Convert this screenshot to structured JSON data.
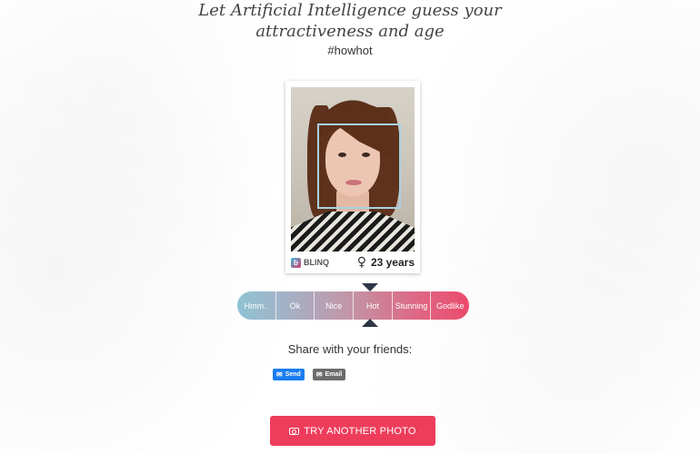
{
  "header": {
    "line1": "Let Artificial Intelligence guess your",
    "line2": "attractiveness and age",
    "hashtag": "#howhot"
  },
  "card": {
    "brand": "BLINQ",
    "brand_logo_letter": "b",
    "gender_symbol": "♀",
    "age": "23 years"
  },
  "rating": {
    "labels": [
      "Hmm..",
      "Ok",
      "Nice",
      "Hot",
      "Stunning",
      "Godlike"
    ],
    "selected": "Hot"
  },
  "share": {
    "title": "Share with your friends:",
    "send_label": "Send",
    "email_label": "Email",
    "send_icon": "messenger-icon",
    "email_icon": "envelope-icon"
  },
  "cta": {
    "label": "TRY ANOTHER PHOTO",
    "icon": "camera-icon",
    "color": "#ee3d5b"
  }
}
